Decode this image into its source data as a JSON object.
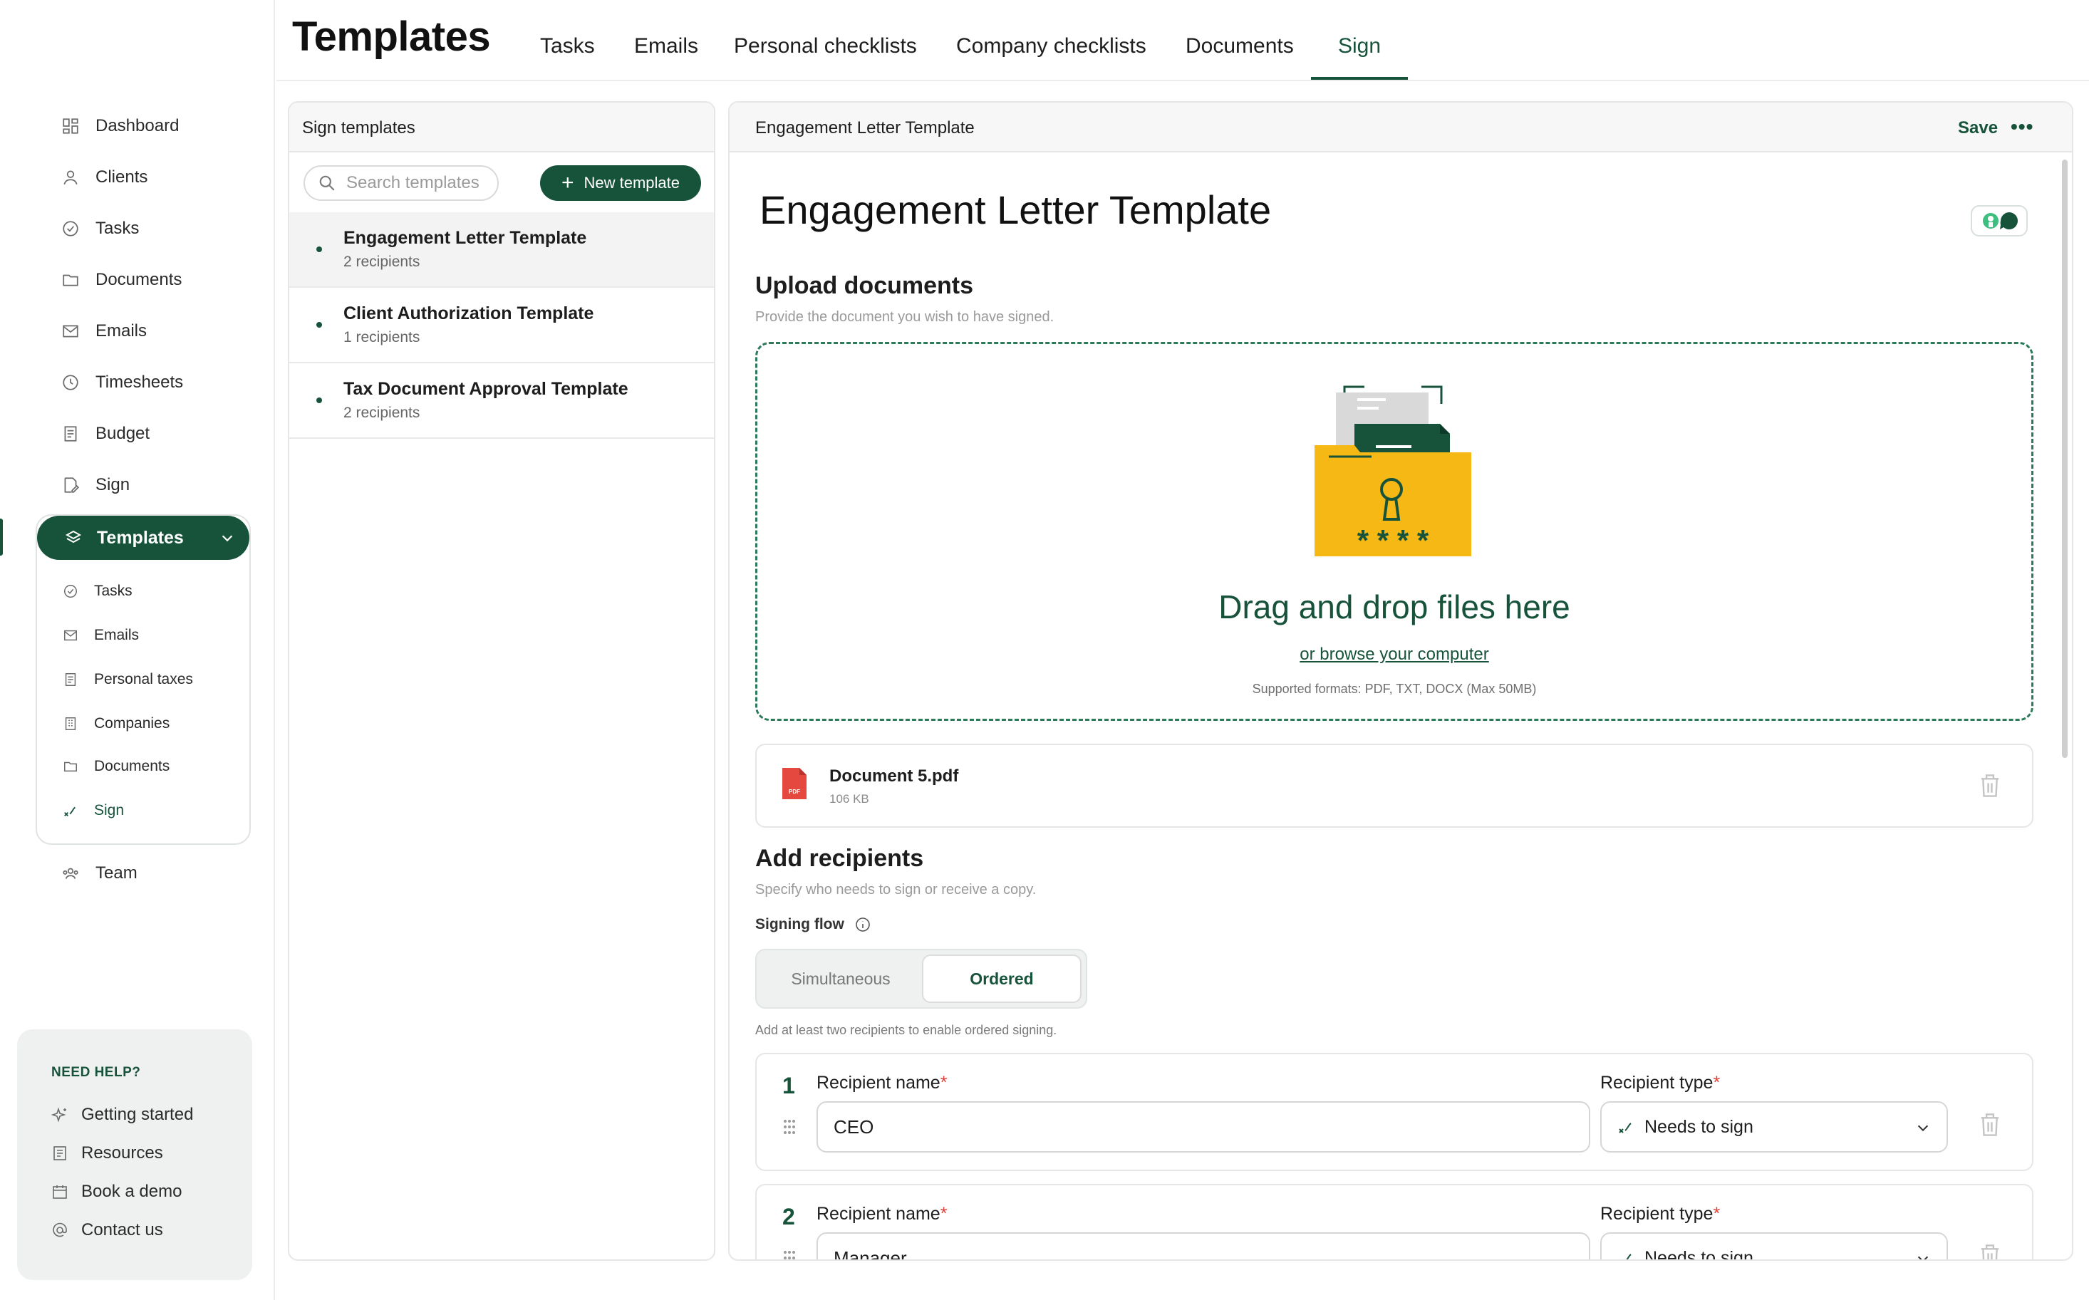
{
  "sidebar": {
    "nav": [
      {
        "label": "Dashboard",
        "icon": "dashboard-icon"
      },
      {
        "label": "Clients",
        "icon": "user-icon"
      },
      {
        "label": "Tasks",
        "icon": "check-circle-icon"
      },
      {
        "label": "Documents",
        "icon": "folder-icon"
      },
      {
        "label": "Emails",
        "icon": "mail-icon"
      },
      {
        "label": "Timesheets",
        "icon": "clock-icon"
      },
      {
        "label": "Budget",
        "icon": "receipt-icon"
      },
      {
        "label": "Sign",
        "icon": "sign-icon"
      }
    ],
    "templates": {
      "label": "Templates",
      "icon": "layers-icon"
    },
    "sub": [
      {
        "label": "Tasks",
        "icon": "check-circle-icon"
      },
      {
        "label": "Emails",
        "icon": "mail-icon"
      },
      {
        "label": "Personal taxes",
        "icon": "receipt-icon"
      },
      {
        "label": "Companies",
        "icon": "building-icon"
      },
      {
        "label": "Documents",
        "icon": "folder-icon"
      },
      {
        "label": "Sign",
        "icon": "signature-icon"
      }
    ],
    "team": {
      "label": "Team",
      "icon": "team-icon"
    },
    "help": {
      "title": "NEED HELP?",
      "items": [
        {
          "label": "Getting started",
          "icon": "sparkles-icon"
        },
        {
          "label": "Resources",
          "icon": "book-icon"
        },
        {
          "label": "Book a demo",
          "icon": "calendar-icon"
        },
        {
          "label": "Contact us",
          "icon": "at-icon"
        }
      ]
    }
  },
  "header": {
    "title": "Templates",
    "tabs": [
      "Tasks",
      "Emails",
      "Personal checklists",
      "Company checklists",
      "Documents",
      "Sign"
    ],
    "active_tab": "Sign"
  },
  "list": {
    "title": "Sign templates",
    "search_placeholder": "Search templates",
    "new_button": "New template",
    "items": [
      {
        "name": "Engagement Letter Template",
        "recipients": "2 recipients"
      },
      {
        "name": "Client Authorization Template",
        "recipients": "1 recipients"
      },
      {
        "name": "Tax Document Approval Template",
        "recipients": "2 recipients"
      }
    ]
  },
  "editor": {
    "header_title": "Engagement Letter Template",
    "save": "Save",
    "more": "•••",
    "title": "Engagement Letter Template",
    "upload": {
      "title": "Upload documents",
      "desc": "Provide the document you wish to have signed.",
      "drop_title": "Drag and drop files here",
      "browse": "or browse your computer",
      "hint": "Supported formats: PDF, TXT, DOCX (Max 50MB)"
    },
    "file": {
      "name": "Document 5.pdf",
      "size": "106 KB"
    },
    "recipients": {
      "title": "Add recipients",
      "desc": "Specify who needs to sign or receive a copy.",
      "flow_label": "Signing flow",
      "flow_options": [
        "Simultaneous",
        "Ordered"
      ],
      "flow_selected": "Ordered",
      "flow_hint": "Add at least two recipients to enable ordered signing.",
      "name_label": "Recipient name",
      "type_label": "Recipient type",
      "required_mark": "*",
      "rows": [
        {
          "index": "1",
          "name": "CEO",
          "type": "Needs to sign"
        },
        {
          "index": "2",
          "name": "Manager",
          "type": "Needs to sign"
        }
      ]
    }
  },
  "colors": {
    "accent": "#17533b",
    "required": "#e2403a",
    "folder": "#f5b815",
    "pdf": "#e5483f"
  }
}
